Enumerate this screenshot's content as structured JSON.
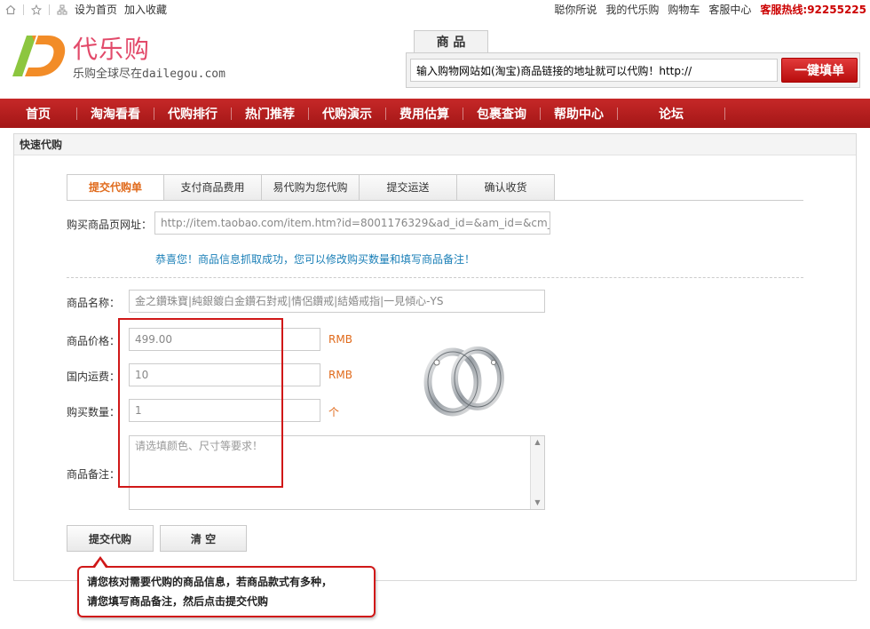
{
  "topbar": {
    "links_left": [
      "设为首页",
      "加入收藏"
    ],
    "links_right": [
      "聪你所说",
      "我的代乐购",
      "购物车",
      "客服中心"
    ],
    "hotline": "客服热线:92255225"
  },
  "logo": {
    "brand": "代乐购",
    "slogan": "乐购全球尽在dailegou.com"
  },
  "search": {
    "tab": "商 品",
    "value": "输入购物网站如(淘宝)商品链接的地址就可以代购！http://",
    "button": "一键填单"
  },
  "nav": {
    "items": [
      "首页",
      "淘淘看看",
      "代购排行",
      "热门推荐",
      "代购演示",
      "费用估算",
      "包裹查询",
      "帮助中心",
      "论坛"
    ]
  },
  "panel": {
    "title": "快速代购"
  },
  "steps": [
    "提交代购单",
    "支付商品费用",
    "易代购为您代购",
    "提交运送",
    "确认收货"
  ],
  "form": {
    "url_label": "购买商品页网址：",
    "url_value": "http://item.taobao.com/item.htm?id=8001176329&ad_id=&am_id=&cm_id=&",
    "success_msg": "恭喜您！商品信息抓取成功，您可以修改购买数量和填写商品备注！",
    "name_label": "商品名称：",
    "name_value": "金之鑽珠寶|純銀鍍白金鑽石對戒|情侶鑽戒|結婚戒指|一見傾心-YS",
    "price_label": "商品价格：",
    "price_value": "499.00",
    "price_unit": "RMB",
    "ship_label": "国内运费：",
    "ship_value": "10",
    "ship_unit": "RMB",
    "qty_label": "购买数量：",
    "qty_value": "1",
    "qty_unit": "个",
    "note_label": "商品备注：",
    "note_placeholder": "请选填颜色、尺寸等要求！",
    "submit": "提交代购",
    "clear": "清  空"
  },
  "callout": {
    "line1": "请您核对需要代购的商品信息，若商品款式有多种，",
    "line2": "请您填写商品备注，然后点击提交代购"
  },
  "colors": {
    "nav_red": "#b71c1c",
    "accent_orange": "#e06a1b",
    "brand_pink": "#e24a6a",
    "link_blue": "#1a7fb7"
  }
}
